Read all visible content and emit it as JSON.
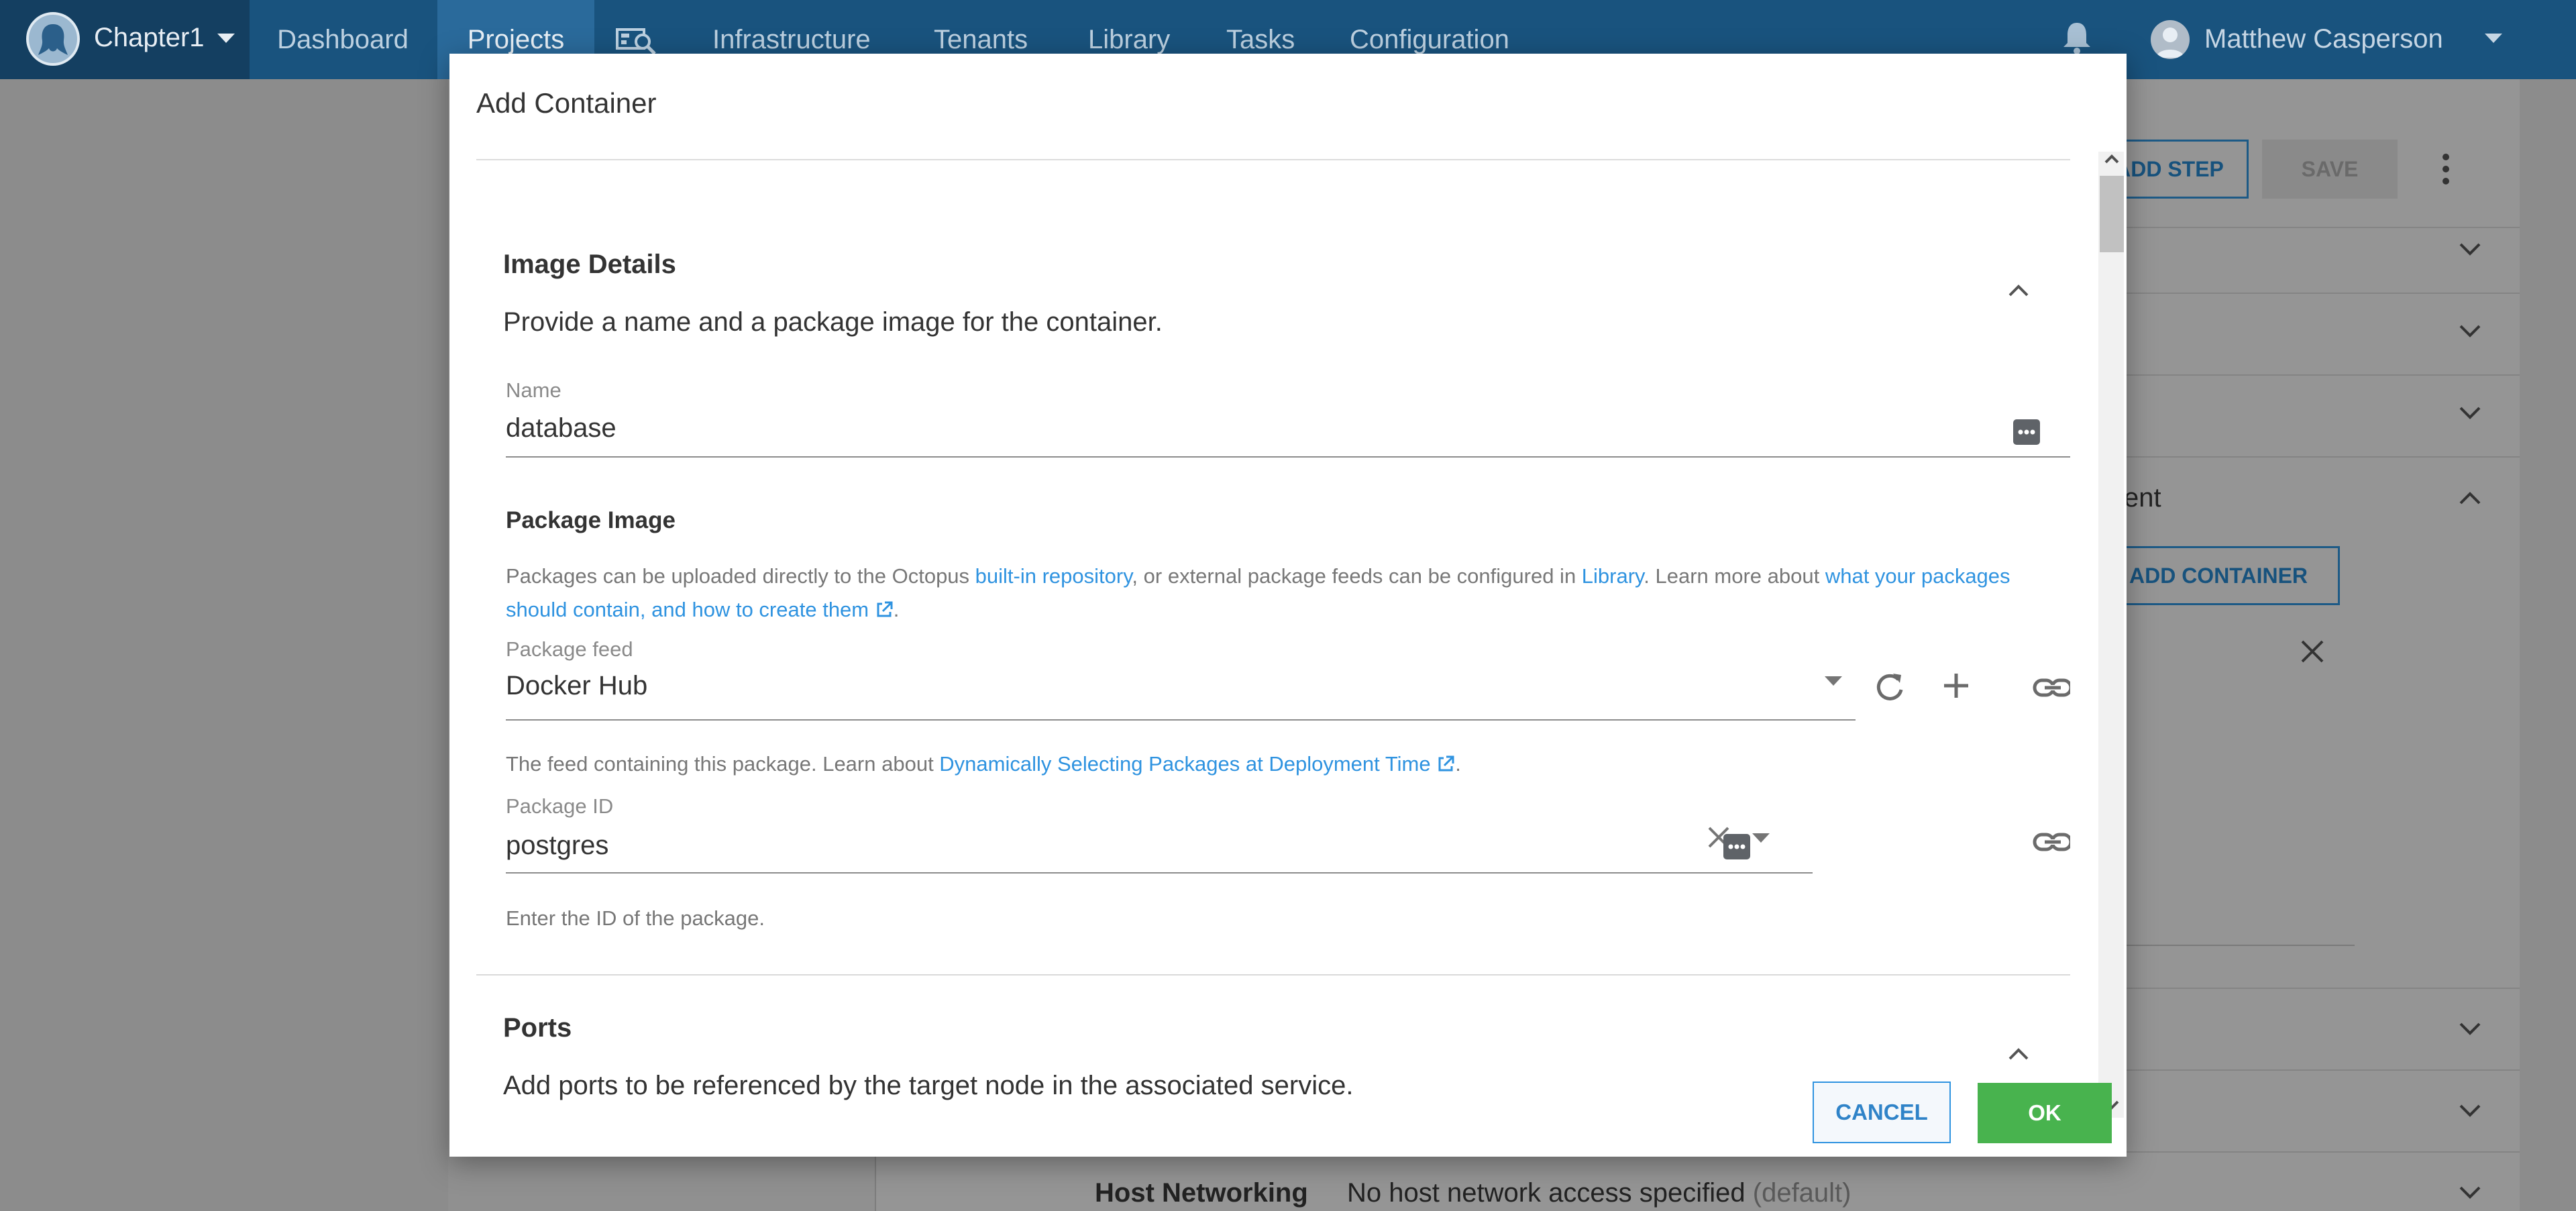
{
  "topnav": {
    "space_name": "Chapter1",
    "items": [
      {
        "label": "Dashboard"
      },
      {
        "label": "Projects"
      },
      {
        "label": "Infrastructure"
      },
      {
        "label": "Tenants"
      },
      {
        "label": "Library"
      },
      {
        "label": "Tasks"
      },
      {
        "label": "Configuration"
      }
    ],
    "active_item": "Projects",
    "user_name": "Matthew Casperson"
  },
  "background": {
    "add_step_label": "ADD STEP",
    "save_label": "SAVE",
    "add_container_label": "ADD CONTAINER",
    "section_fragment": "ent",
    "host_networking_label": "Host Networking",
    "host_networking_value": "No host network access specified",
    "host_networking_default": "(default)"
  },
  "dialog": {
    "title": "Add Container",
    "image_details": {
      "title": "Image Details",
      "description": "Provide a name and a package image for the container.",
      "name_label": "Name",
      "name_value": "database"
    },
    "package_image": {
      "title": "Package Image",
      "hint_part1": "Packages can be uploaded directly to the Octopus ",
      "hint_link1": "built-in repository",
      "hint_part2": ", or external package feeds can be configured in ",
      "hint_link2": "Library",
      "hint_part3": ". Learn more about ",
      "hint_link3": "what your packages should contain, and how to create them",
      "hint_end": ".",
      "feed_label": "Package feed",
      "feed_value": "Docker Hub",
      "feed_hint_part1": "The feed containing this package. Learn about ",
      "feed_hint_link": "Dynamically Selecting Packages at Deployment Time",
      "feed_hint_end": ".",
      "package_id_label": "Package ID",
      "package_id_value": "postgres",
      "package_id_hint": "Enter the ID of the package."
    },
    "ports": {
      "title": "Ports",
      "description": "Add ports to be referenced by the target node in the associated service."
    },
    "cancel_label": "CANCEL",
    "ok_label": "OK"
  },
  "colors": {
    "nav_bg": "#19537e",
    "ok_green": "#48b34e",
    "link_blue": "#2f93e0"
  }
}
